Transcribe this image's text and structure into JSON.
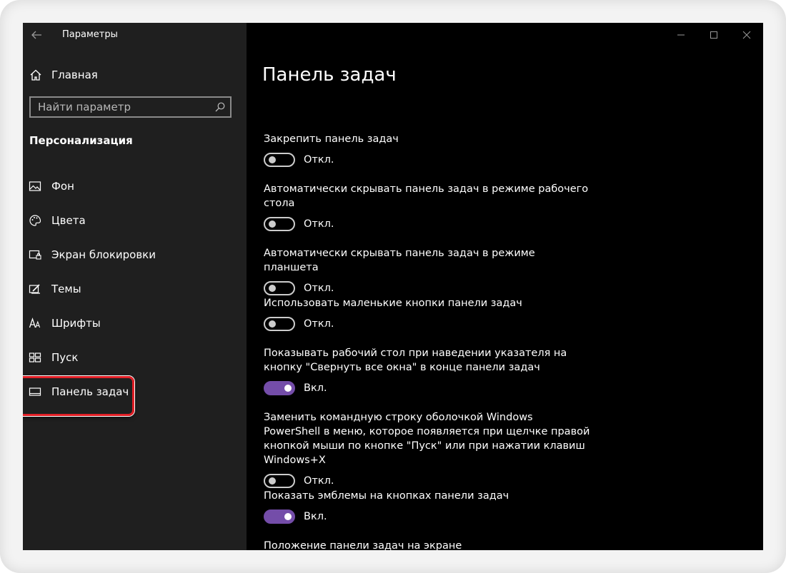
{
  "window": {
    "title": "Параметры"
  },
  "sidebar": {
    "home_label": "Главная",
    "search_placeholder": "Найти параметр",
    "section_title": "Персонализация",
    "items": [
      {
        "label": "Фон",
        "icon": "image-icon"
      },
      {
        "label": "Цвета",
        "icon": "palette-icon"
      },
      {
        "label": "Экран блокировки",
        "icon": "lock-screen-icon"
      },
      {
        "label": "Темы",
        "icon": "themes-icon"
      },
      {
        "label": "Шрифты",
        "icon": "fonts-icon"
      },
      {
        "label": "Пуск",
        "icon": "start-icon"
      },
      {
        "label": "Панель задач",
        "icon": "taskbar-icon",
        "selected": true
      }
    ]
  },
  "main": {
    "title": "Панель задач",
    "settings": [
      {
        "label": "Закрепить панель задач",
        "state": "Откл.",
        "on": false
      },
      {
        "label": "Автоматически скрывать панель задач в режиме рабочего стола",
        "state": "Откл.",
        "on": false
      },
      {
        "label": "Автоматически скрывать панель задач в режиме планшета",
        "state": "Откл.",
        "on": false
      },
      {
        "label": "Использовать маленькие кнопки панели задач",
        "state": "Откл.",
        "on": false
      },
      {
        "label": "Показывать рабочий стол при наведении указателя на кнопку \"Свернуть все окна\" в конце панели задач",
        "state": "Вкл.",
        "on": true
      },
      {
        "label": "Заменить командную строку оболочкой Windows PowerShell в меню, которое появляется при щелчке правой кнопкой мыши по кнопке \"Пуск\" или при нажатии клавиш Windows+X",
        "state": "Откл.",
        "on": false
      },
      {
        "label": "Показать эмблемы на кнопках панели задач",
        "state": "Вкл.",
        "on": true
      }
    ],
    "partial_heading": "Положение панели задач на экране"
  },
  "colors": {
    "accent": "#744da9",
    "highlight_border": "#e11f26",
    "sidebar_bg": "#1f1f1f",
    "main_bg": "#000000"
  }
}
